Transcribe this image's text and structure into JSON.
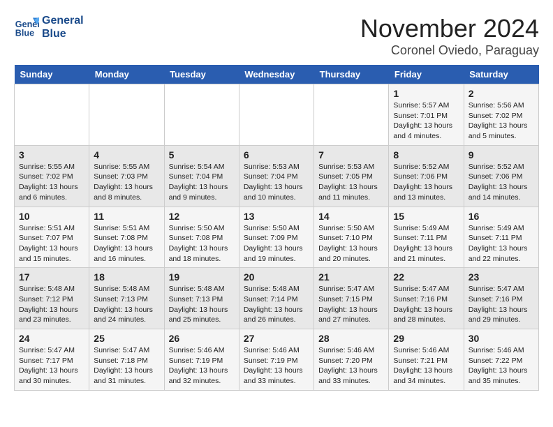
{
  "logo": {
    "line1": "General",
    "line2": "Blue"
  },
  "title": "November 2024",
  "location": "Coronel Oviedo, Paraguay",
  "days_of_week": [
    "Sunday",
    "Monday",
    "Tuesday",
    "Wednesday",
    "Thursday",
    "Friday",
    "Saturday"
  ],
  "weeks": [
    [
      {
        "day": "",
        "info": ""
      },
      {
        "day": "",
        "info": ""
      },
      {
        "day": "",
        "info": ""
      },
      {
        "day": "",
        "info": ""
      },
      {
        "day": "",
        "info": ""
      },
      {
        "day": "1",
        "info": "Sunrise: 5:57 AM\nSunset: 7:01 PM\nDaylight: 13 hours\nand 4 minutes."
      },
      {
        "day": "2",
        "info": "Sunrise: 5:56 AM\nSunset: 7:02 PM\nDaylight: 13 hours\nand 5 minutes."
      }
    ],
    [
      {
        "day": "3",
        "info": "Sunrise: 5:55 AM\nSunset: 7:02 PM\nDaylight: 13 hours\nand 6 minutes."
      },
      {
        "day": "4",
        "info": "Sunrise: 5:55 AM\nSunset: 7:03 PM\nDaylight: 13 hours\nand 8 minutes."
      },
      {
        "day": "5",
        "info": "Sunrise: 5:54 AM\nSunset: 7:04 PM\nDaylight: 13 hours\nand 9 minutes."
      },
      {
        "day": "6",
        "info": "Sunrise: 5:53 AM\nSunset: 7:04 PM\nDaylight: 13 hours\nand 10 minutes."
      },
      {
        "day": "7",
        "info": "Sunrise: 5:53 AM\nSunset: 7:05 PM\nDaylight: 13 hours\nand 11 minutes."
      },
      {
        "day": "8",
        "info": "Sunrise: 5:52 AM\nSunset: 7:06 PM\nDaylight: 13 hours\nand 13 minutes."
      },
      {
        "day": "9",
        "info": "Sunrise: 5:52 AM\nSunset: 7:06 PM\nDaylight: 13 hours\nand 14 minutes."
      }
    ],
    [
      {
        "day": "10",
        "info": "Sunrise: 5:51 AM\nSunset: 7:07 PM\nDaylight: 13 hours\nand 15 minutes."
      },
      {
        "day": "11",
        "info": "Sunrise: 5:51 AM\nSunset: 7:08 PM\nDaylight: 13 hours\nand 16 minutes."
      },
      {
        "day": "12",
        "info": "Sunrise: 5:50 AM\nSunset: 7:08 PM\nDaylight: 13 hours\nand 18 minutes."
      },
      {
        "day": "13",
        "info": "Sunrise: 5:50 AM\nSunset: 7:09 PM\nDaylight: 13 hours\nand 19 minutes."
      },
      {
        "day": "14",
        "info": "Sunrise: 5:50 AM\nSunset: 7:10 PM\nDaylight: 13 hours\nand 20 minutes."
      },
      {
        "day": "15",
        "info": "Sunrise: 5:49 AM\nSunset: 7:11 PM\nDaylight: 13 hours\nand 21 minutes."
      },
      {
        "day": "16",
        "info": "Sunrise: 5:49 AM\nSunset: 7:11 PM\nDaylight: 13 hours\nand 22 minutes."
      }
    ],
    [
      {
        "day": "17",
        "info": "Sunrise: 5:48 AM\nSunset: 7:12 PM\nDaylight: 13 hours\nand 23 minutes."
      },
      {
        "day": "18",
        "info": "Sunrise: 5:48 AM\nSunset: 7:13 PM\nDaylight: 13 hours\nand 24 minutes."
      },
      {
        "day": "19",
        "info": "Sunrise: 5:48 AM\nSunset: 7:13 PM\nDaylight: 13 hours\nand 25 minutes."
      },
      {
        "day": "20",
        "info": "Sunrise: 5:48 AM\nSunset: 7:14 PM\nDaylight: 13 hours\nand 26 minutes."
      },
      {
        "day": "21",
        "info": "Sunrise: 5:47 AM\nSunset: 7:15 PM\nDaylight: 13 hours\nand 27 minutes."
      },
      {
        "day": "22",
        "info": "Sunrise: 5:47 AM\nSunset: 7:16 PM\nDaylight: 13 hours\nand 28 minutes."
      },
      {
        "day": "23",
        "info": "Sunrise: 5:47 AM\nSunset: 7:16 PM\nDaylight: 13 hours\nand 29 minutes."
      }
    ],
    [
      {
        "day": "24",
        "info": "Sunrise: 5:47 AM\nSunset: 7:17 PM\nDaylight: 13 hours\nand 30 minutes."
      },
      {
        "day": "25",
        "info": "Sunrise: 5:47 AM\nSunset: 7:18 PM\nDaylight: 13 hours\nand 31 minutes."
      },
      {
        "day": "26",
        "info": "Sunrise: 5:46 AM\nSunset: 7:19 PM\nDaylight: 13 hours\nand 32 minutes."
      },
      {
        "day": "27",
        "info": "Sunrise: 5:46 AM\nSunset: 7:19 PM\nDaylight: 13 hours\nand 33 minutes."
      },
      {
        "day": "28",
        "info": "Sunrise: 5:46 AM\nSunset: 7:20 PM\nDaylight: 13 hours\nand 33 minutes."
      },
      {
        "day": "29",
        "info": "Sunrise: 5:46 AM\nSunset: 7:21 PM\nDaylight: 13 hours\nand 34 minutes."
      },
      {
        "day": "30",
        "info": "Sunrise: 5:46 AM\nSunset: 7:22 PM\nDaylight: 13 hours\nand 35 minutes."
      }
    ]
  ]
}
